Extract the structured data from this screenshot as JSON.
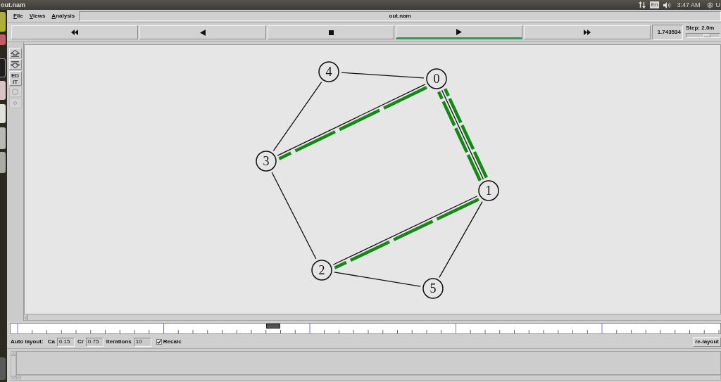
{
  "top_panel": {
    "window_title": "out.nam",
    "keyboard_layout": "En",
    "clock": "3:47 AM",
    "user": "U"
  },
  "menu": [
    {
      "label": "File"
    },
    {
      "label": "Views"
    },
    {
      "label": "Analysis"
    }
  ],
  "file_field": {
    "value": "out.nam"
  },
  "transport": [
    {
      "kind": "rewind",
      "selected": false
    },
    {
      "kind": "reverse",
      "selected": false
    },
    {
      "kind": "stop",
      "selected": false
    },
    {
      "kind": "play",
      "selected": true
    },
    {
      "kind": "fast_forward",
      "selected": false
    }
  ],
  "time": {
    "value": "1.743534"
  },
  "step": {
    "label": "Step: 2.0m",
    "level": 0.62
  },
  "tools": [
    {
      "kind": "zoom_in"
    },
    {
      "kind": "zoom_out"
    },
    {
      "kind": "edit",
      "label": "ED IT"
    },
    {
      "kind": "circle"
    },
    {
      "kind": "small_circle"
    }
  ],
  "network": {
    "nodes": [
      {
        "label": "4"
      },
      {
        "label": "0"
      },
      {
        "label": "3"
      },
      {
        "label": "1"
      },
      {
        "label": "2"
      },
      {
        "label": "5"
      }
    ],
    "links": [
      {
        "packets_forward": false,
        "packets_backward": false
      },
      {
        "packets_forward": false,
        "packets_backward": false
      },
      {
        "packets_forward": true,
        "packets_backward": false
      },
      {
        "packets_forward": true,
        "packets_backward": true
      },
      {
        "packets_forward": false,
        "packets_backward": false
      },
      {
        "packets_forward": true,
        "packets_backward": false
      },
      {
        "packets_forward": false,
        "packets_backward": false
      },
      {
        "packets_forward": false,
        "packets_backward": false
      }
    ]
  },
  "timeline": {
    "level": 0.37
  },
  "auto_layout": {
    "label": "Auto layout:",
    "parameters": [
      {
        "label": "Ca",
        "value": "0.15"
      },
      {
        "label": "Cr",
        "value": "0.75"
      },
      {
        "label": "Iterations",
        "value": "10"
      }
    ],
    "recalc": {
      "label": "Recalc",
      "checked": true
    },
    "relayout_button": "re-layout"
  }
}
